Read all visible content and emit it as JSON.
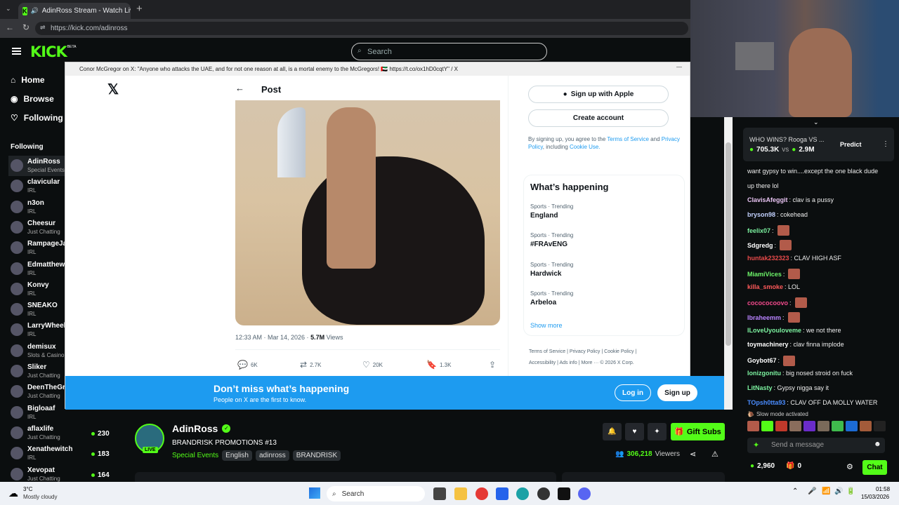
{
  "browser": {
    "tab_title": "AdinRoss Stream - Watch Live",
    "url": "https://kick.com/adinross"
  },
  "header": {
    "logo": "KICK",
    "logo_badge": "BETA",
    "search_placeholder": "Search"
  },
  "sidebar": {
    "nav": [
      {
        "label": "Home"
      },
      {
        "label": "Browse"
      },
      {
        "label": "Following"
      }
    ],
    "section_title": "Following",
    "channels": [
      {
        "name": "AdinRoss",
        "category": "Special Events",
        "viewers": ""
      },
      {
        "name": "clavicular",
        "category": "IRL",
        "viewers": ""
      },
      {
        "name": "n3on",
        "category": "IRL",
        "viewers": ""
      },
      {
        "name": "Cheesur",
        "category": "Just Chatting",
        "viewers": ""
      },
      {
        "name": "RampageJa",
        "category": "IRL",
        "viewers": ""
      },
      {
        "name": "Edmatthew",
        "category": "IRL",
        "viewers": ""
      },
      {
        "name": "Konvy",
        "category": "IRL",
        "viewers": ""
      },
      {
        "name": "SNEAKO",
        "category": "IRL",
        "viewers": ""
      },
      {
        "name": "LarryWheel",
        "category": "IRL",
        "viewers": ""
      },
      {
        "name": "demisux",
        "category": "Slots & Casino",
        "viewers": ""
      },
      {
        "name": "Sliker",
        "category": "Just Chatting",
        "viewers": ""
      },
      {
        "name": "DeenTheGr",
        "category": "Just Chatting",
        "viewers": ""
      },
      {
        "name": "Bigloaaf",
        "category": "IRL",
        "viewers": ""
      },
      {
        "name": "aflaxlife",
        "category": "Just Chatting",
        "viewers": "230"
      },
      {
        "name": "Xenathewitch",
        "category": "IRL",
        "viewers": "183"
      },
      {
        "name": "Xevopat",
        "category": "Just Chatting",
        "viewers": "164"
      }
    ]
  },
  "popup": {
    "title": "Conor McGregor on X: \"Anyone who attacks the UAE, and for not one reason at all, is a mortal enemy to the McGregors! 🇦🇪 https://t.co/ox1hD0cqtY\" / X",
    "post_header": "Post",
    "meta_time": "12:33 AM · Mar 14, 2026 · ",
    "meta_views_num": "5.7M",
    "meta_views_label": "Views",
    "actions": [
      "6K",
      "2.7K",
      "20K",
      "1.3K"
    ],
    "signup_apple": "Sign up with Apple",
    "create_account": "Create account",
    "terms_pre": "By signing up, you agree to the ",
    "terms_link": "Terms of Service",
    "terms_and": " and ",
    "privacy_link": "Privacy Policy",
    "terms_mid": ", including ",
    "cookie_link": "Cookie Use.",
    "happening_title": "What’s happening",
    "trends": [
      {
        "category": "Sports · Trending",
        "name": "England"
      },
      {
        "category": "Sports · Trending",
        "name": "#FRAvENG"
      },
      {
        "category": "Sports · Trending",
        "name": "Hardwick"
      },
      {
        "category": "Sports · Trending",
        "name": "Arbeloa"
      }
    ],
    "show_more": "Show more",
    "footer_links": [
      "Terms of Service",
      "Privacy Policy",
      "Cookie Policy",
      "Accessibility",
      "Ads info",
      "More ···",
      "© 2026 X Corp."
    ],
    "banner_title": "Don’t miss what’s happening",
    "banner_sub": "People on X are the first to know.",
    "login": "Log in",
    "signup": "Sign up"
  },
  "stream": {
    "streamer": "AdinRoss",
    "live_badge": "LIVE",
    "title": "BRANDRISK PROMOTIONS #13",
    "category": "Special Events",
    "tags": [
      "English",
      "adinross",
      "BRANDRISK"
    ],
    "gift_subs": "Gift Subs",
    "viewers_num": "306,218",
    "viewers_label": "Viewers"
  },
  "prediction": {
    "question": "WHO WINS? Rooga VS ...",
    "left_amount": "705.3K",
    "vs": "vs",
    "right_amount": "2.9M",
    "button": "Predict"
  },
  "chat": {
    "messages": [
      {
        "user": "",
        "text": "want gypsy to win....except the one black dude",
        "color": "#eeeeee",
        "emote": false
      },
      {
        "user": "",
        "text": "up there lol",
        "color": "#eeeeee",
        "emote": false
      },
      {
        "user": "ClavisAfeggit",
        "text": ": clav is a pussy",
        "color": "#e8c3f2",
        "emote": false
      },
      {
        "user": "bryson98",
        "text": ": cokehead",
        "color": "#c3d2ff",
        "emote": false
      },
      {
        "user": "feelix07",
        "text": ":",
        "color": "#7cf2a0",
        "emote": true
      },
      {
        "user": "Sdgredg",
        "text": ":",
        "color": "#ffffff",
        "emote": true
      },
      {
        "user": "huntak232323",
        "text": ": CLAV HIGH ASF",
        "color": "#e84a4a",
        "emote": false
      },
      {
        "user": "MiamiVices",
        "text": ":",
        "color": "#6ef56a",
        "emote": true
      },
      {
        "user": "killa_smoke",
        "text": ": LOL",
        "color": "#ff5a5a",
        "emote": false
      },
      {
        "user": "cocococoovo",
        "text": ":",
        "color": "#f24a8c",
        "emote": true
      },
      {
        "user": "Ibraheemm",
        "text": ":",
        "color": "#b983ff",
        "emote": true
      },
      {
        "user": "ILoveUyouloveme",
        "text": ": we not there",
        "color": "#7cf2a0",
        "emote": false
      },
      {
        "user": "toymachinery",
        "text": ": clav finna implode",
        "color": "#ffffff",
        "emote": false
      },
      {
        "user": "Goybot67",
        "text": ":",
        "color": "#ffffff",
        "emote": true
      },
      {
        "user": "Ionizgonitu",
        "text": ": big nosed stroid on fuck",
        "color": "#7cf2a0",
        "emote": false
      },
      {
        "user": "LitNasty",
        "text": ": Gypsy nigga say it",
        "color": "#7cf2a0",
        "emote": false
      },
      {
        "user": "TOpsh0tta93",
        "text": ": CLAV OFF DA MOLLY WATER",
        "color": "#4a8cff",
        "emote": false
      }
    ],
    "slow_mode": "Slow mode activated",
    "input_placeholder": "Send a message",
    "points": "2,960",
    "gifts": "0",
    "chat_button": "Chat"
  },
  "taskbar": {
    "temp": "3°C",
    "weather": "Mostly cloudy",
    "search": "Search",
    "time": "01:58",
    "date": "15/03/2026"
  }
}
